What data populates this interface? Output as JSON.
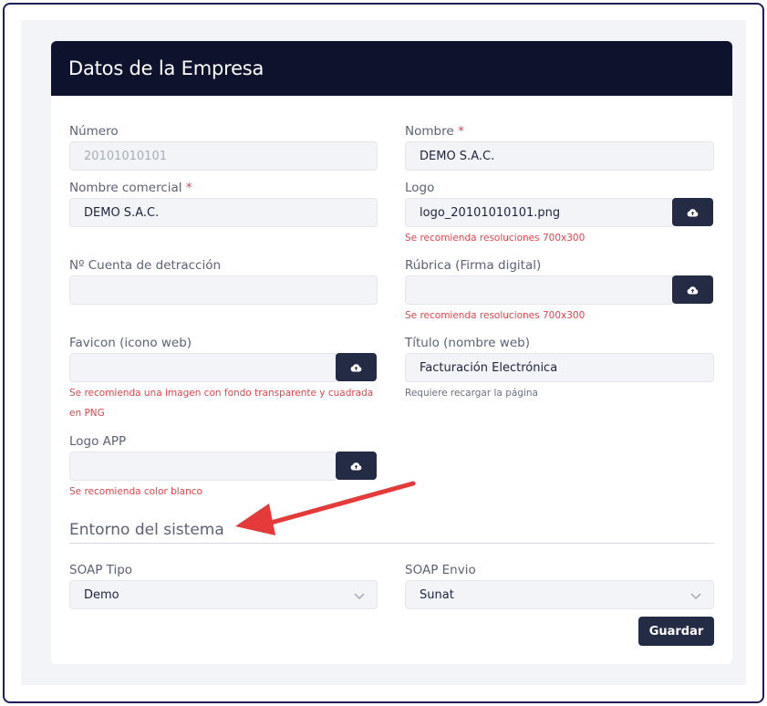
{
  "card": {
    "title": "Datos de la Empresa"
  },
  "fields": {
    "numero": {
      "label": "Número",
      "value": "20101010101"
    },
    "nombre": {
      "label": "Nombre",
      "required_mark": "*",
      "value": "DEMO S.A.C."
    },
    "nombre_comercial": {
      "label": "Nombre comercial",
      "required_mark": "*",
      "value": "DEMO S.A.C."
    },
    "logo": {
      "label": "Logo",
      "value": "logo_20101010101.png",
      "hint": "Se recomienda resoluciones 700x300"
    },
    "cuenta_detraccion": {
      "label": "Nº Cuenta de detracción",
      "value": ""
    },
    "rubrica": {
      "label": "Rúbrica (Firma digital)",
      "value": "",
      "hint": "Se recomienda resoluciones 700x300"
    },
    "favicon": {
      "label": "Favicon (icono web)",
      "value": "",
      "hint_line1": "Se recomienda una imagen con fondo transparente y cuadrada",
      "hint_line2": "en PNG"
    },
    "titulo": {
      "label": "Título (nombre web)",
      "value": "Facturación Electrónica",
      "hint": "Requiere recargar la página"
    },
    "logo_app": {
      "label": "Logo APP",
      "value": "",
      "hint": "Se recomienda color blanco"
    }
  },
  "section": {
    "title": "Entorno del sistema"
  },
  "soap": {
    "tipo": {
      "label": "SOAP Tipo",
      "selected": "Demo"
    },
    "envio": {
      "label": "SOAP Envio",
      "selected": "Sunat"
    }
  },
  "actions": {
    "save_label": "Guardar"
  },
  "icons": {
    "upload": "cloud-upload-icon",
    "chevron": "chevron-down-icon",
    "annotation": "red-arrow-annotation"
  },
  "colors": {
    "header_bg": "#0d132d",
    "button_bg": "#242b45",
    "required": "#e5434b",
    "annotation_arrow": "#e53a3a"
  }
}
